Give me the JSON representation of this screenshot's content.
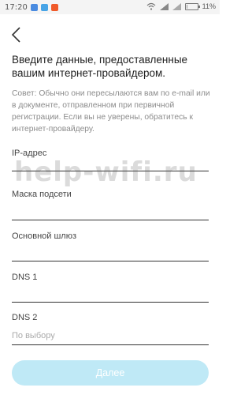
{
  "status_bar": {
    "time": "17:20",
    "battery": "11%",
    "battery_level": 0.11,
    "notification_icons": [
      "vk-icon",
      "mail-icon",
      "app-icon"
    ],
    "notification_colors": [
      "#4a8be0",
      "#47a4e6",
      "#f05a2a"
    ]
  },
  "header": {
    "back_icon": "chevron-left-icon",
    "title": "Введите данные, предоставленные вашим интернет-провайдером.",
    "tip": "Совет: Обычно они пересылаются вам по e-mail или в документе, отправленном при первичной регистрации. Если вы не уверены, обратитесь к интернет-провайдеру."
  },
  "form": {
    "ip_label": "IP-адрес",
    "mask_label": "Маска подсети",
    "gateway_label": "Основной шлюз",
    "dns1_label": "DNS 1",
    "dns2_label": "DNS 2",
    "dns2_placeholder": "По выбору"
  },
  "actions": {
    "next_label": "Далее",
    "next_color": "#bfe9f6"
  },
  "watermark": "help-wifi.ru"
}
